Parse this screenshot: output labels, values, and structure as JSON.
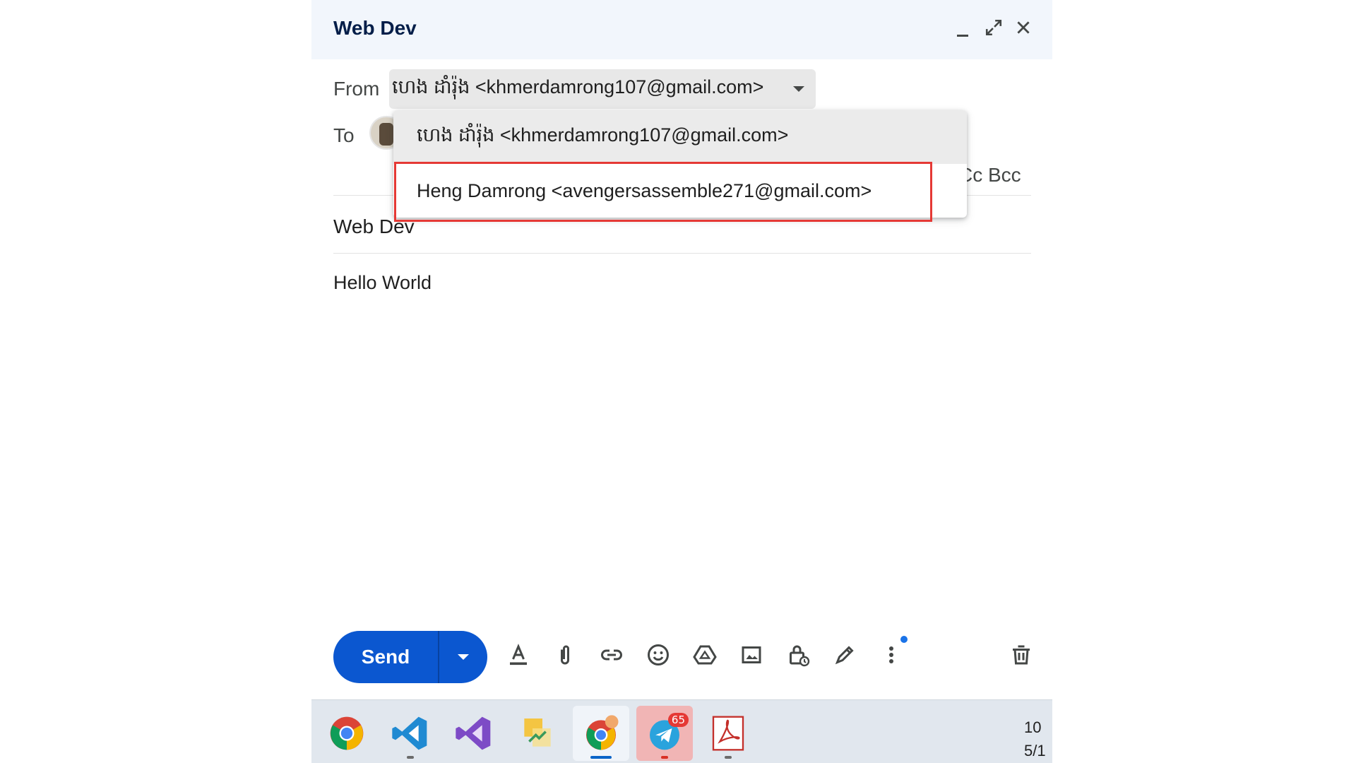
{
  "compose": {
    "title": "Web Dev",
    "from_label": "From",
    "from_value": "ហេង ដាំរ៉ុង <khmerdamrong107@gmail.com>",
    "to_label": "To",
    "cc_bcc": "Cc Bcc",
    "subject": "Web Dev",
    "body": "Hello World"
  },
  "dropdown": {
    "options": [
      "ហេង ដាំរ៉ុង <khmerdamrong107@gmail.com>",
      "Heng Damrong <avengersassemble271@gmail.com>"
    ]
  },
  "toolbar": {
    "send_label": "Send",
    "icons": [
      "formatting-icon",
      "attach-icon",
      "link-icon",
      "emoji-icon",
      "drive-icon",
      "image-icon",
      "confidential-icon",
      "signature-icon",
      "more-options-icon",
      "delete-icon"
    ]
  },
  "taskbar": {
    "apps": [
      "chrome",
      "vscode",
      "visual-studio",
      "photo-app",
      "chrome-profile",
      "telegram",
      "acrobat"
    ],
    "telegram_badge": "65",
    "clock_time": "10",
    "clock_date": "5/1"
  },
  "colors": {
    "accent": "#0b57d0",
    "header_bg": "#f2f6fc",
    "highlight": "#e53935"
  }
}
